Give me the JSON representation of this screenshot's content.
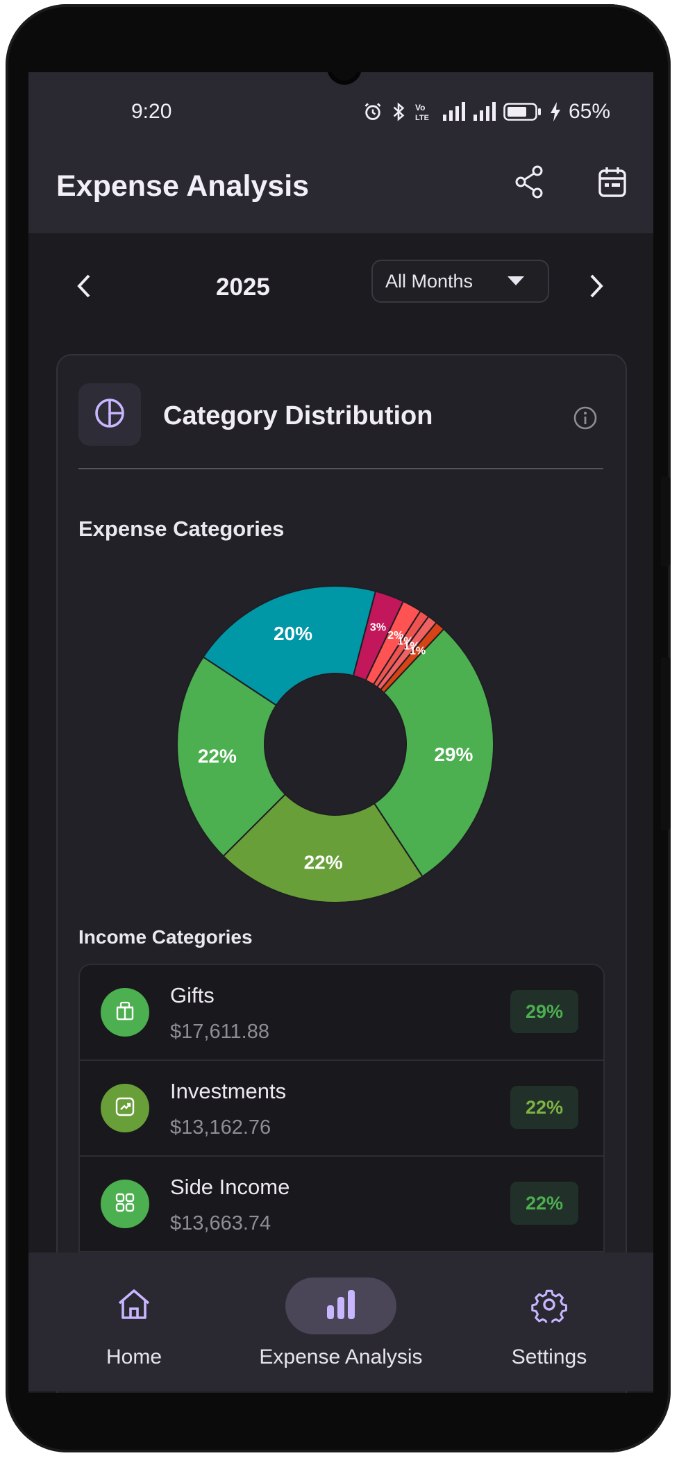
{
  "status_bar": {
    "time": "9:20",
    "battery": "65%"
  },
  "app_bar": {
    "title": "Expense Analysis"
  },
  "period": {
    "year": "2025",
    "month_select": "All Months"
  },
  "card": {
    "title": "Category Distribution"
  },
  "expense_section": {
    "title": "Expense Categories"
  },
  "income_section": {
    "title": "Income Categories"
  },
  "chart_data": {
    "type": "pie",
    "donut": true,
    "slices": [
      {
        "label": "29%",
        "value": 29,
        "color": "#4caf50"
      },
      {
        "label": "22%",
        "value": 22,
        "color": "#689f38"
      },
      {
        "label": "22%",
        "value": 22,
        "color": "#4caf50"
      },
      {
        "label": "20%",
        "value": 20,
        "color": "#0097a7"
      },
      {
        "label": "3%",
        "value": 3,
        "color": "#c2185b"
      },
      {
        "label": "2%",
        "value": 2,
        "color": "#ff5252"
      },
      {
        "label": "1%",
        "value": 1,
        "color": "#ef5350"
      },
      {
        "label": "1%",
        "value": 1,
        "color": "#f06262"
      },
      {
        "label": "1%",
        "value": 1,
        "color": "#d84315"
      }
    ]
  },
  "income_rows": [
    {
      "name": "Gifts",
      "amount": "$17,611.88",
      "percent": "29%",
      "color": "#4caf50",
      "icon": "gift-icon"
    },
    {
      "name": "Investments",
      "amount": "$13,162.76",
      "percent": "22%",
      "color": "#689f38",
      "icon": "trending-up-icon"
    },
    {
      "name": "Side Income",
      "amount": "$13,663.74",
      "percent": "22%",
      "color": "#4caf50",
      "icon": "grid-icon"
    }
  ],
  "nav": {
    "items": [
      {
        "label": "Home",
        "icon": "home-icon"
      },
      {
        "label": "Expense Analysis",
        "icon": "bar-chart-icon"
      },
      {
        "label": "Settings",
        "icon": "gear-icon"
      }
    ],
    "accent": "#c8b6ff"
  }
}
